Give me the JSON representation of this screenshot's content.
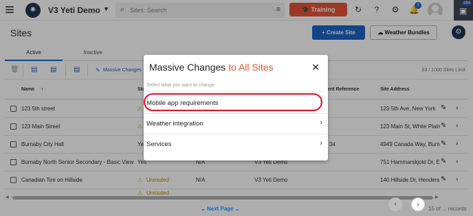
{
  "topbar": {
    "org_name": "V3 Yeti Demo",
    "search_placeholder": "Sites: Search",
    "training_label": "Training",
    "notifications_count": "3",
    "chat_count": "294"
  },
  "page": {
    "title": "Sites",
    "create_label": "+ Create Site",
    "weather_label": "Weather Bundles"
  },
  "tabs": [
    {
      "label": "Active"
    },
    {
      "label": "Inactive"
    }
  ],
  "toolbar": {
    "massive_label": "Massive Changes",
    "limit_text": "83 / 1000 Sites Limit"
  },
  "table": {
    "headers": {
      "name": "Name",
      "status": "Sta",
      "reference": "ent Reference",
      "address": "Site Address"
    },
    "rows": [
      {
        "name": "123 5th street",
        "status": "",
        "col3": "",
        "col4": "",
        "address": "123 5th Ave, New York"
      },
      {
        "name": "123 Main Street",
        "status": "",
        "col3": "",
        "col4": "",
        "address": "123 Main St, White Plain"
      },
      {
        "name": "Burnaby City Hall",
        "status": "Ye",
        "col3": "",
        "col4": "34",
        "address": "4949 Canada Way, Burn"
      },
      {
        "name": "Burnaby North Senior Secondary - Basic View",
        "status": "Yes",
        "col3": "N/A",
        "col4": "V3 Yeti Demo",
        "address": "751 Hammarskjold Dr, E"
      },
      {
        "name": "Canadian Tire on Hillside",
        "status": "Unrouted",
        "col3": "N/A",
        "col4": "V3 Yeti Demo",
        "address": "140 Hillside Dr, Henders"
      },
      {
        "name": "",
        "status": "Unrouted",
        "col3": "",
        "col4": "",
        "address": ""
      }
    ]
  },
  "footer": {
    "next_page": "Next Page",
    "records": "15 of ... records"
  },
  "modal": {
    "title_plain": "Massive Changes",
    "title_accent": "to All Sites",
    "subtitle": "Select what you want to change",
    "items": [
      {
        "label": "Mobile app requirements"
      },
      {
        "label": "Weather integration"
      },
      {
        "label": "Services"
      }
    ]
  },
  "colors": {
    "accent_blue": "#1a66c9",
    "accent_orange": "#e8533a",
    "highlight_red": "#e0102a"
  }
}
